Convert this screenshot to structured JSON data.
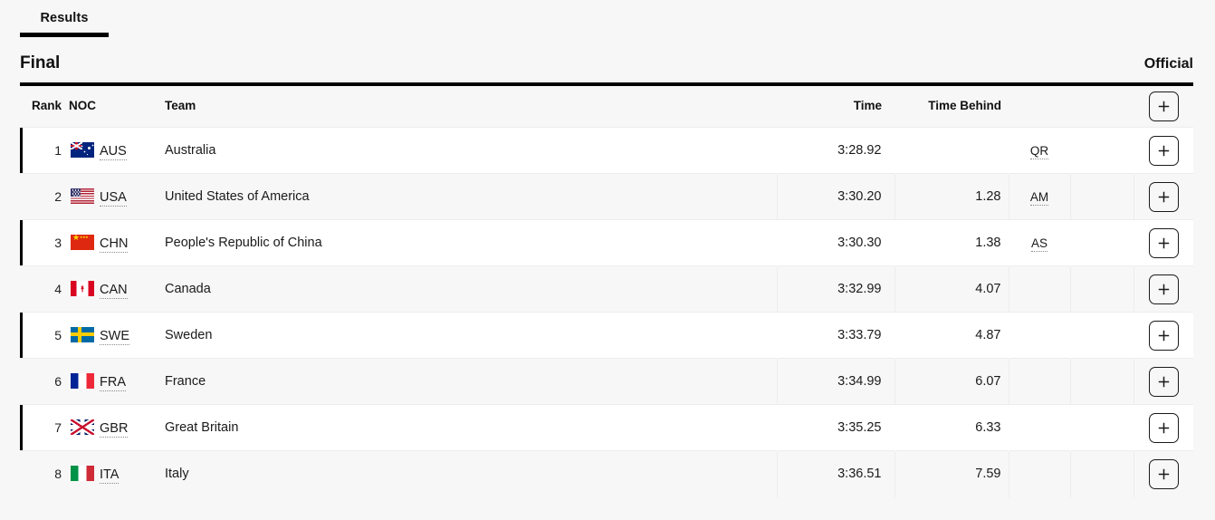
{
  "tabs": [
    {
      "label": "Results",
      "active": true
    }
  ],
  "section": {
    "title": "Final",
    "status": "Official"
  },
  "table": {
    "headers": {
      "rank": "Rank",
      "noc": "NOC",
      "team": "Team",
      "time": "Time",
      "time_behind": "Time Behind",
      "record": "",
      "extra": "",
      "expand": "+"
    },
    "expand_all_label": "+",
    "rows": [
      {
        "rank": "1",
        "noc": "AUS",
        "flag": "flag-aus",
        "team": "Australia",
        "time": "3:28.92",
        "time_behind": "",
        "record": "QR",
        "expand": "+"
      },
      {
        "rank": "2",
        "noc": "USA",
        "flag": "flag-usa",
        "team": "United States of America",
        "time": "3:30.20",
        "time_behind": "1.28",
        "record": "AM",
        "expand": "+"
      },
      {
        "rank": "3",
        "noc": "CHN",
        "flag": "flag-chn",
        "team": "People's Republic of China",
        "time": "3:30.30",
        "time_behind": "1.38",
        "record": "AS",
        "expand": "+"
      },
      {
        "rank": "4",
        "noc": "CAN",
        "flag": "flag-can",
        "team": "Canada",
        "time": "3:32.99",
        "time_behind": "4.07",
        "record": "",
        "expand": "+"
      },
      {
        "rank": "5",
        "noc": "SWE",
        "flag": "flag-swe",
        "team": "Sweden",
        "time": "3:33.79",
        "time_behind": "4.87",
        "record": "",
        "expand": "+"
      },
      {
        "rank": "6",
        "noc": "FRA",
        "flag": "flag-fra",
        "team": "France",
        "time": "3:34.99",
        "time_behind": "6.07",
        "record": "",
        "expand": "+"
      },
      {
        "rank": "7",
        "noc": "GBR",
        "flag": "flag-gbr",
        "team": "Great Britain",
        "time": "3:35.25",
        "time_behind": "6.33",
        "record": "",
        "expand": "+"
      },
      {
        "rank": "8",
        "noc": "ITA",
        "flag": "flag-ita",
        "team": "Italy",
        "time": "3:36.51",
        "time_behind": "7.59",
        "record": "",
        "expand": "+"
      }
    ]
  },
  "colors": {
    "page_background": "#f7f7f7",
    "row_odd": "#ffffff",
    "row_even": "#f7f7f7",
    "text": "#1a1a1a",
    "rule": "#000000",
    "cell_border": "#ededed"
  }
}
